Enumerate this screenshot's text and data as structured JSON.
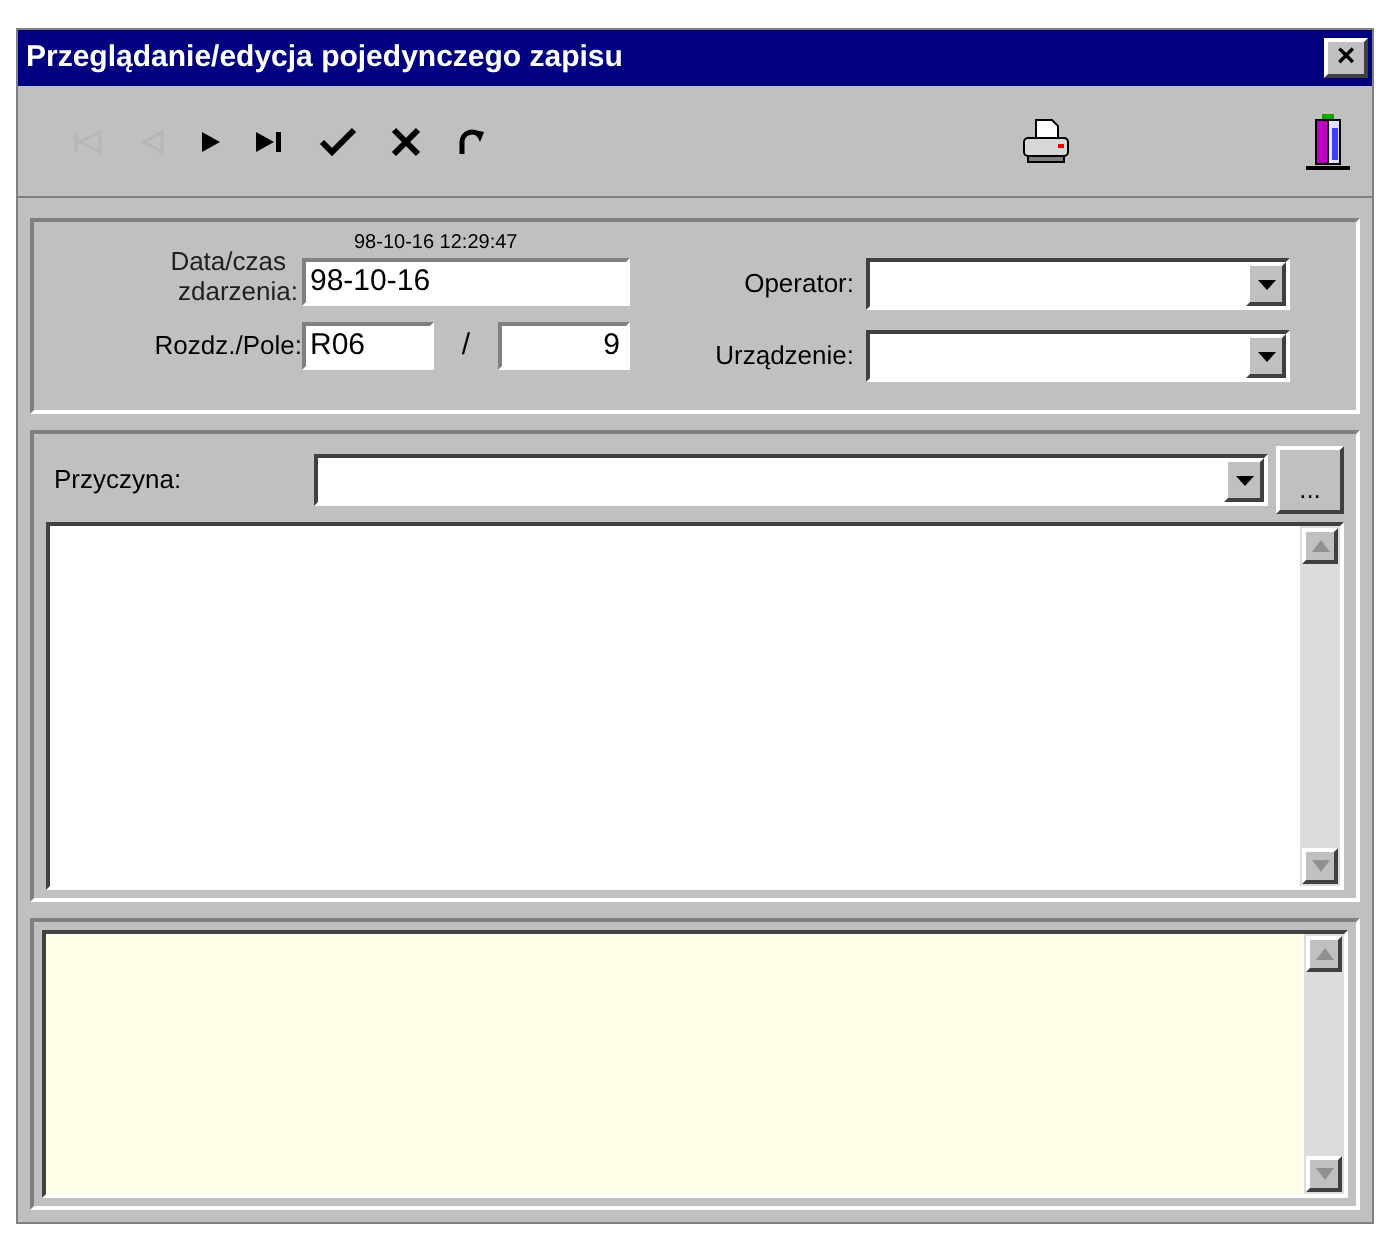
{
  "window": {
    "title": "Przeglądanie/edycja pojedynczego zapisu",
    "close": "×"
  },
  "toolbar": [
    {
      "kind": "first",
      "disabled": true
    },
    {
      "kind": "prev",
      "disabled": true
    },
    {
      "kind": "next",
      "disabled": false
    },
    {
      "kind": "last",
      "disabled": false
    },
    {
      "kind": "accept",
      "disabled": false
    },
    {
      "kind": "cancel",
      "disabled": false
    },
    {
      "kind": "refresh",
      "disabled": false
    },
    {
      "kind": "print",
      "disabled": false
    },
    {
      "kind": "exit",
      "disabled": false
    }
  ],
  "header": {
    "timestamp": "98-10-16 12:29:47",
    "date_label": [
      "Data/czas",
      "zdarzenia:"
    ],
    "date_value": "98-10-16",
    "section_label": "Rozdz./Pole:",
    "section_value": "R06",
    "separator": "/",
    "field_value": "9",
    "operator_label": "Operator:",
    "device_label": "Urządzenie:"
  },
  "reason": {
    "label": "Przyczyna:",
    "browse": "..."
  }
}
